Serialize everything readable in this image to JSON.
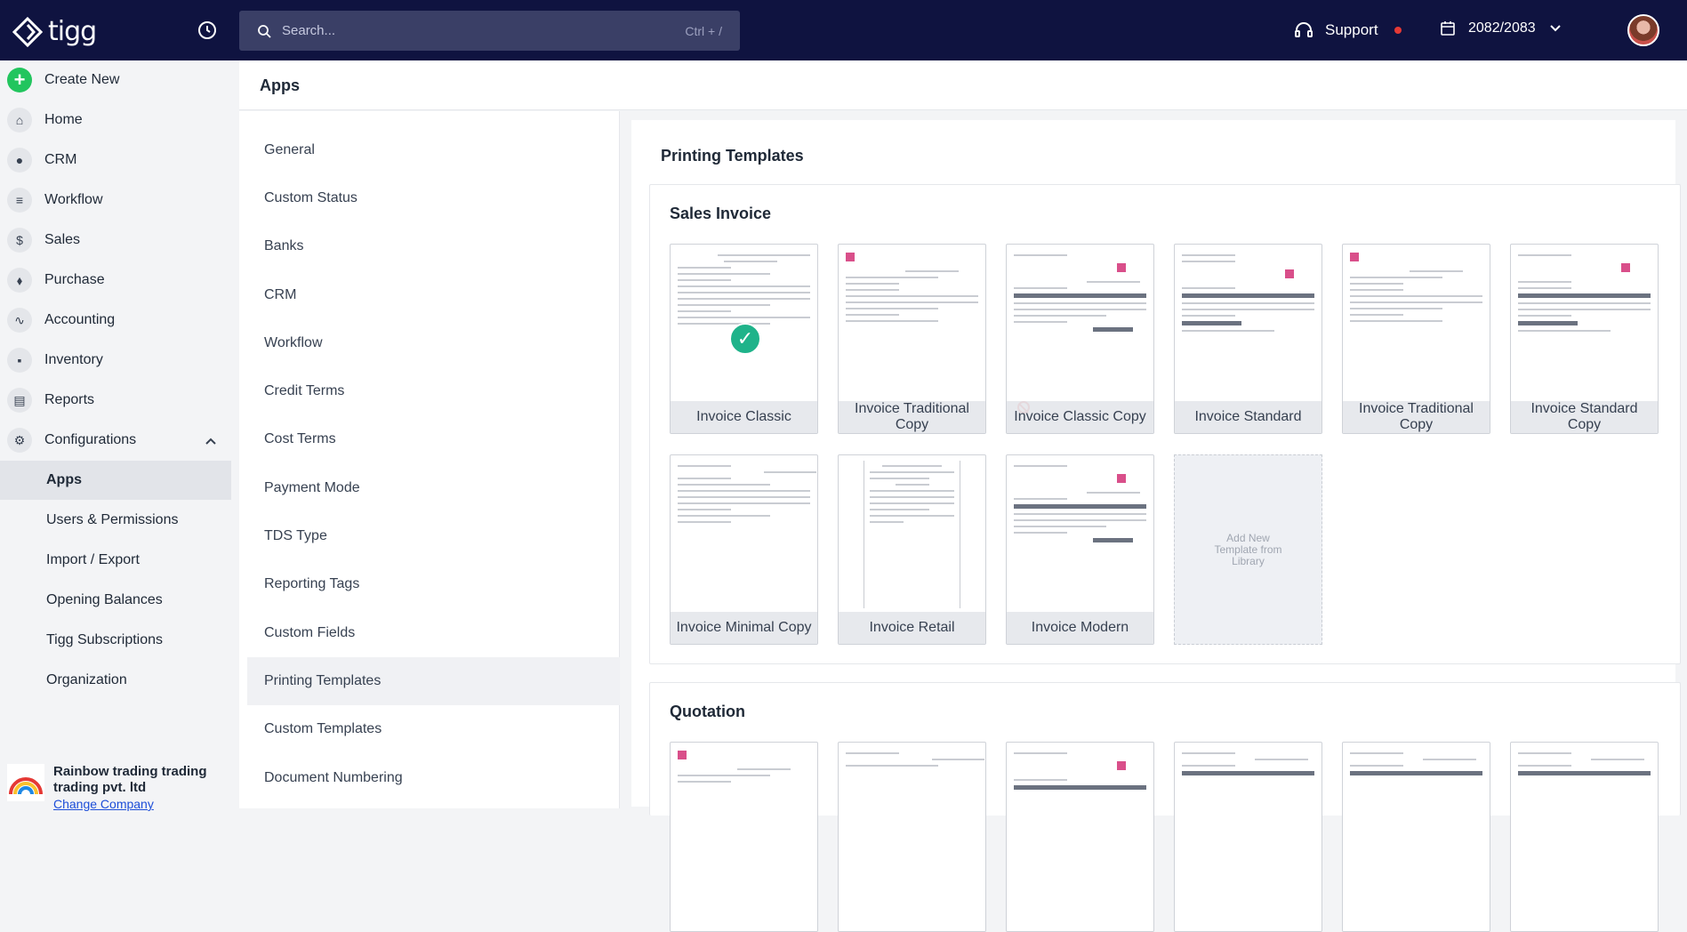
{
  "topbar": {
    "brand": "tigg",
    "search_placeholder": "Search...",
    "search_shortcut": "Ctrl + /",
    "support_label": "Support",
    "fiscal_year": "2082/2083"
  },
  "sidebar": {
    "create_new": "Create New",
    "items": [
      "Home",
      "CRM",
      "Workflow",
      "Sales",
      "Purchase",
      "Accounting",
      "Inventory",
      "Reports",
      "Configurations"
    ],
    "sub_items": [
      "Apps",
      "Users & Permissions",
      "Import / Export",
      "Opening Balances",
      "Tigg Subscriptions",
      "Organization"
    ],
    "company_name": "Rainbow trading trading trading pvt. ltd",
    "change_company": "Change Company"
  },
  "header": {
    "title": "Apps"
  },
  "submenu": [
    "General",
    "Custom Status",
    "Banks",
    "CRM",
    "Workflow",
    "Credit Terms",
    "Cost Terms",
    "Payment Mode",
    "TDS Type",
    "Reporting Tags",
    "Custom Fields",
    "Printing Templates",
    "Custom Templates",
    "Document Numbering"
  ],
  "main": {
    "title": "Printing Templates",
    "sales_invoice": {
      "title": "Sales Invoice",
      "templates": [
        "Invoice Classic",
        "Invoice Traditional Copy",
        "Invoice Classic Copy",
        "Invoice Standard",
        "Invoice Traditional Copy",
        "Invoice Standard Copy",
        "Invoice Minimal Copy",
        "Invoice Retail",
        "Invoice Modern"
      ],
      "add_new": "Add New Template from Library"
    },
    "quotation": {
      "title": "Quotation"
    }
  }
}
